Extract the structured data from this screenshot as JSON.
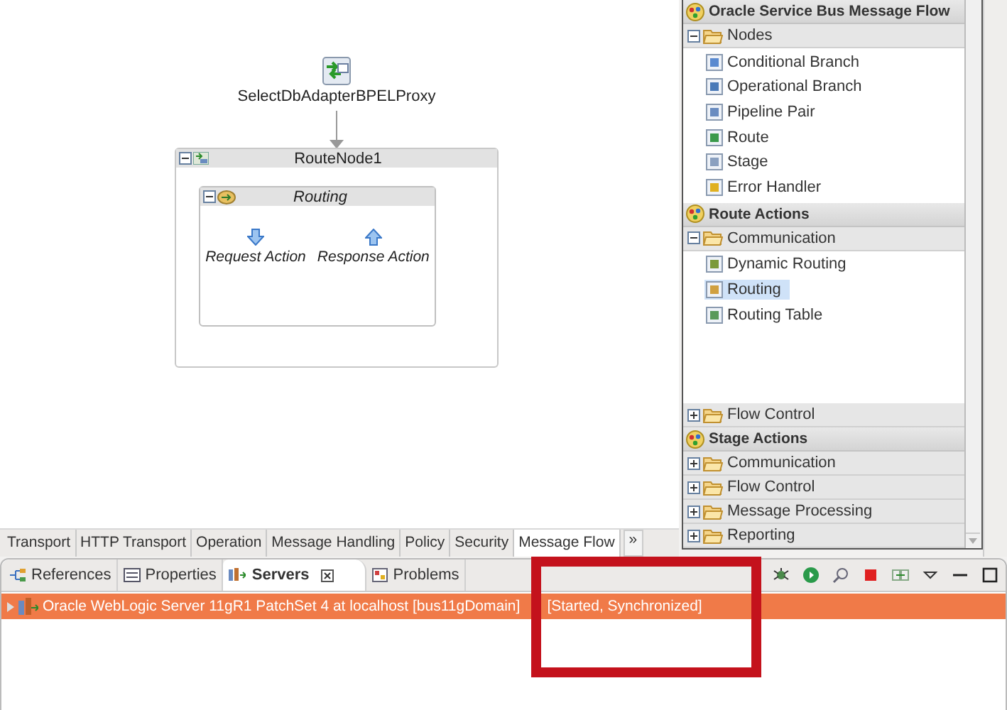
{
  "diagram": {
    "proxy": {
      "label": "SelectDbAdapterBPELProxy"
    },
    "route_node": {
      "title": "RouteNode1",
      "expanded": true
    },
    "routing": {
      "title": "Routing",
      "expanded": true
    },
    "actions": [
      {
        "label": "Request Action",
        "kind": "request"
      },
      {
        "label": "Response Action",
        "kind": "response"
      }
    ]
  },
  "palette": {
    "sections": [
      {
        "title": "Oracle Service Bus Message Flow",
        "folders": [
          {
            "label": "Nodes",
            "expanded": true,
            "items": [
              {
                "label": "Conditional Branch",
                "selected": false
              },
              {
                "label": "Operational Branch",
                "selected": false
              },
              {
                "label": "Pipeline Pair",
                "selected": false
              },
              {
                "label": "Route",
                "selected": false
              },
              {
                "label": "Stage",
                "selected": false
              },
              {
                "label": "Error Handler",
                "selected": false
              }
            ]
          }
        ]
      },
      {
        "title": "Route Actions",
        "folders": [
          {
            "label": "Communication",
            "expanded": true,
            "items": [
              {
                "label": "Dynamic Routing",
                "selected": false
              },
              {
                "label": "Routing",
                "selected": true
              },
              {
                "label": "Routing Table",
                "selected": false
              }
            ]
          },
          {
            "label": "Flow Control",
            "expanded": false
          }
        ]
      },
      {
        "title": "Stage Actions",
        "folders": [
          {
            "label": "Communication",
            "expanded": false
          },
          {
            "label": "Flow Control",
            "expanded": false
          },
          {
            "label": "Message Processing",
            "expanded": false
          },
          {
            "label": "Reporting",
            "expanded": false
          }
        ]
      }
    ]
  },
  "editor_tabs": [
    {
      "label": "Transport",
      "selected": false
    },
    {
      "label": "HTTP Transport",
      "selected": false
    },
    {
      "label": "Operation",
      "selected": false
    },
    {
      "label": "Message Handling",
      "selected": false
    },
    {
      "label": "Policy",
      "selected": false
    },
    {
      "label": "Security",
      "selected": false
    },
    {
      "label": "Message Flow",
      "selected": true
    }
  ],
  "editor_tabs_overflow": "»",
  "view_tabs": [
    {
      "label": "References",
      "selected": false,
      "kind": "references"
    },
    {
      "label": "Properties",
      "selected": false,
      "kind": "properties"
    },
    {
      "label": "Servers",
      "selected": true,
      "kind": "servers"
    },
    {
      "label": "Problems",
      "selected": false,
      "kind": "problems"
    }
  ],
  "servers": [
    {
      "name": "Oracle WebLogic Server 11gR1 PatchSet 4 at localhost [bus11gDomain]",
      "state": "[Started, Synchronized]",
      "selected": true,
      "expanded": false
    }
  ],
  "highlight": {
    "visible": true
  }
}
